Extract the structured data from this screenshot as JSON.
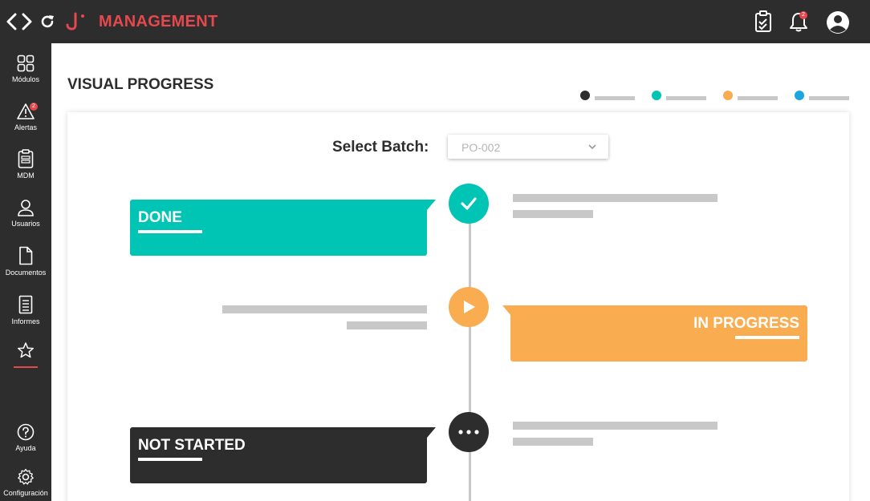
{
  "header": {
    "brand_title": "MANAGEMENT",
    "notification_count": "2",
    "icons": [
      "code-icon",
      "refresh-icon",
      "brand-logo-icon",
      "clipboard-check-icon",
      "bell-icon",
      "user-avatar-icon"
    ]
  },
  "sidebar": {
    "items": [
      {
        "label": "Módulos",
        "icon": "grid-icon"
      },
      {
        "label": "Alertas",
        "icon": "warning-icon",
        "badge": "2"
      },
      {
        "label": "MDM",
        "icon": "clipboard-list-icon"
      },
      {
        "label": "Usuarios",
        "icon": "user-icon"
      },
      {
        "label": "Documentos",
        "icon": "document-icon"
      },
      {
        "label": "Informes",
        "icon": "report-icon"
      },
      {
        "label": "",
        "icon": "star-icon"
      },
      {
        "label": "Ayuda",
        "icon": "help-icon"
      },
      {
        "label": "Configuración",
        "icon": "gear-icon"
      }
    ]
  },
  "main": {
    "title": "VISUAL PROGRESS",
    "legend_colors": [
      "#2d2d2d",
      "#00c5b5",
      "#f9ad50",
      "#1ba6e0"
    ],
    "batch_label": "Select Batch:",
    "batch_value": "PO-002",
    "statuses": [
      {
        "title": "DONE",
        "color": "#00c5b5",
        "icon": "checkmark-icon"
      },
      {
        "title": "IN PROGRESS",
        "color": "#f9ad50",
        "icon": "play-icon"
      },
      {
        "title": "NOT STARTED",
        "color": "#2d2d2d",
        "icon": "more-dots-icon"
      }
    ]
  },
  "colors": {
    "topbar": "#2d2d2d",
    "accent": "#e5484d",
    "placeholder": "#c8c8c8"
  }
}
